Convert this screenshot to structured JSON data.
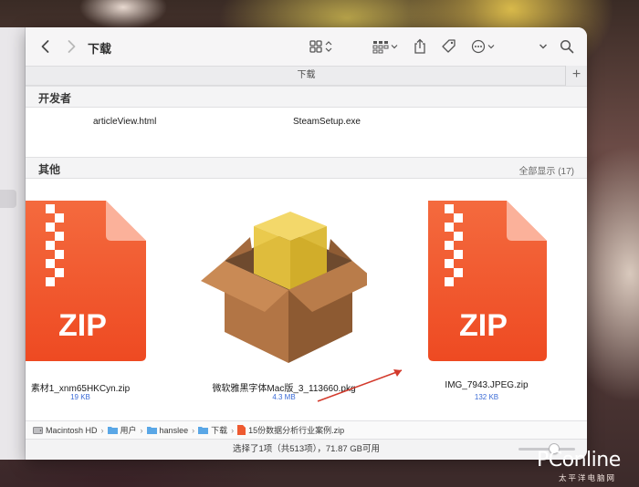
{
  "window": {
    "title": "下载",
    "path_title": "下载"
  },
  "toolbar": {
    "back_icon": "chevron-left-icon",
    "forward_icon": "chevron-right-icon",
    "view_icon": "grid-view-icon",
    "group_icon": "group-icon",
    "share_icon": "share-icon",
    "tag_icon": "tag-icon",
    "more_icon": "ellipsis-icon",
    "search_icon": "search-icon"
  },
  "sections": {
    "developer": {
      "title": "开发者",
      "files": [
        "articleView.html",
        "SteamSetup.exe"
      ]
    },
    "other": {
      "title": "其他",
      "show_all": "全部显示 (17)",
      "files": [
        {
          "name": "素材1_xnm65HKCyn.zip",
          "size": "19 KB",
          "icon": "zip-file-icon"
        },
        {
          "name": "微软雅黑字体Mac版_3_113660.pkg",
          "size": "4.3 MB",
          "icon": "package-box-icon"
        },
        {
          "name": "IMG_7943.JPEG.zip",
          "size": "132 KB",
          "icon": "zip-file-icon"
        }
      ],
      "zip_text": "ZIP"
    }
  },
  "breadcrumb": [
    "Macintosh HD",
    "用户",
    "hanslee",
    "下载",
    "15份数据分析行业案例.zip"
  ],
  "statusbar": {
    "text": "选择了1项（共513项），71.87 GB可用"
  },
  "watermark": {
    "brand": "PConline",
    "sub": "太平洋电脑网"
  },
  "colors": {
    "zip_orange": "#f0532a",
    "selection_blue": "#3b6bd6",
    "annotation_arrow": "#d33a2c"
  }
}
